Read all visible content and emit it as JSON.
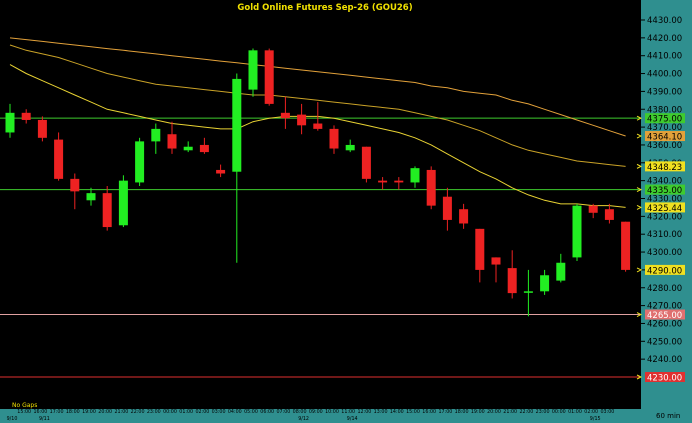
{
  "chart_data": {
    "type": "candlestick",
    "title": "Gold  Online  Futures  Sep-26  (GOU26)",
    "timeframe_label": "60  min",
    "corner_label": "No  Gaps",
    "ylim": [
      4230,
      4440
    ],
    "y_ticks": [
      4240,
      4250,
      4260,
      4270,
      4280,
      4290,
      4300,
      4310,
      4320,
      4330,
      4340,
      4350,
      4360,
      4370,
      4380,
      4390,
      4400,
      4410,
      4420,
      4430
    ],
    "date_labels": [
      {
        "label": "9/10",
        "index": 0
      },
      {
        "label": "9/11",
        "index": 2
      },
      {
        "label": "9/12",
        "index": 18
      },
      {
        "label": "9/14",
        "index": 21
      },
      {
        "label": "9/15",
        "index": 36
      }
    ],
    "time_labels": [
      "15:00",
      "16:00",
      "17:00",
      "18:00",
      "19:00",
      "20:00",
      "21:00",
      "22:00",
      "23:00",
      "00:00",
      "01:00",
      "02:00",
      "03:00",
      "04:00",
      "05:00",
      "06:00",
      "07:00",
      "08:00",
      "09:00",
      "10:00",
      "11:00",
      "12:00",
      "13:00",
      "14:00",
      "15:00",
      "16:00",
      "17:00",
      "18:00",
      "19:00",
      "20:00",
      "21:00",
      "22:00",
      "23:00",
      "00:00",
      "01:00",
      "02:00",
      "03:00"
    ],
    "candles": [
      {
        "o": 4367,
        "h": 4383,
        "l": 4364,
        "c": 4378
      },
      {
        "o": 4378,
        "h": 4380,
        "l": 4372,
        "c": 4374
      },
      {
        "o": 4374,
        "h": 4376,
        "l": 4362,
        "c": 4364
      },
      {
        "o": 4363,
        "h": 4367,
        "l": 4340,
        "c": 4341
      },
      {
        "o": 4341,
        "h": 4344,
        "l": 4324,
        "c": 4334
      },
      {
        "o": 4329,
        "h": 4336,
        "l": 4326,
        "c": 4333
      },
      {
        "o": 4333,
        "h": 4337,
        "l": 4312,
        "c": 4314
      },
      {
        "o": 4315,
        "h": 4343,
        "l": 4314,
        "c": 4340
      },
      {
        "o": 4339,
        "h": 4364,
        "l": 4337,
        "c": 4362
      },
      {
        "o": 4362,
        "h": 4372,
        "l": 4355,
        "c": 4369
      },
      {
        "o": 4366,
        "h": 4373,
        "l": 4355,
        "c": 4358
      },
      {
        "o": 4357,
        "h": 4362,
        "l": 4356,
        "c": 4359
      },
      {
        "o": 4360,
        "h": 4364,
        "l": 4355,
        "c": 4356
      },
      {
        "o": 4346,
        "h": 4349,
        "l": 4342,
        "c": 4344
      },
      {
        "o": 4345,
        "h": 4400,
        "l": 4294,
        "c": 4397
      },
      {
        "o": 4391,
        "h": 4414,
        "l": 4387,
        "c": 4413
      },
      {
        "o": 4413,
        "h": 4414,
        "l": 4382,
        "c": 4383
      },
      {
        "o": 4378,
        "h": 4387,
        "l": 4369,
        "c": 4375
      },
      {
        "o": 4377,
        "h": 4383,
        "l": 4366,
        "c": 4371
      },
      {
        "o": 4372,
        "h": 4384,
        "l": 4368,
        "c": 4369
      },
      {
        "o": 4369,
        "h": 4371,
        "l": 4355,
        "c": 4358
      },
      {
        "o": 4357,
        "h": 4363,
        "l": 4356,
        "c": 4360
      },
      {
        "o": 4359,
        "h": 4359,
        "l": 4339,
        "c": 4341
      },
      {
        "o": 4340,
        "h": 4342,
        "l": 4335,
        "c": 4339
      },
      {
        "o": 4340,
        "h": 4342,
        "l": 4335,
        "c": 4339
      },
      {
        "o": 4339,
        "h": 4348,
        "l": 4336,
        "c": 4347
      },
      {
        "o": 4346,
        "h": 4348,
        "l": 4324,
        "c": 4326
      },
      {
        "o": 4331,
        "h": 4336,
        "l": 4312,
        "c": 4318
      },
      {
        "o": 4324,
        "h": 4327,
        "l": 4313,
        "c": 4316
      },
      {
        "o": 4313,
        "h": 4313,
        "l": 4283,
        "c": 4290
      },
      {
        "o": 4297,
        "h": 4297,
        "l": 4283,
        "c": 4293
      },
      {
        "o": 4291,
        "h": 4301,
        "l": 4274,
        "c": 4277
      },
      {
        "o": 4278,
        "h": 4290,
        "l": 4264,
        "c": 4278
      },
      {
        "o": 4278,
        "h": 4290,
        "l": 4276,
        "c": 4287
      },
      {
        "o": 4284,
        "h": 4299,
        "l": 4283,
        "c": 4294
      },
      {
        "o": 4297,
        "h": 4327,
        "l": 4295,
        "c": 4326
      },
      {
        "o": 4326,
        "h": 4327,
        "l": 4319,
        "c": 4322
      },
      {
        "o": 4324,
        "h": 4327,
        "l": 4316,
        "c": 4318
      },
      {
        "o": 4317,
        "h": 4317,
        "l": 4289,
        "c": 4290
      }
    ],
    "moving_averages": [
      {
        "color": "#e2a13a",
        "values": [
          4420,
          4419,
          4418,
          4417,
          4416,
          4415,
          4414,
          4413,
          4412,
          4411,
          4410,
          4409,
          4408,
          4407,
          4406,
          4405,
          4404,
          4403,
          4402,
          4401,
          4400,
          4399,
          4398,
          4397,
          4396,
          4395,
          4393,
          4392,
          4390,
          4389,
          4388,
          4385,
          4383,
          4380,
          4377,
          4374,
          4371,
          4368,
          4365
        ]
      },
      {
        "color": "#c9a227",
        "values": [
          4416,
          4413,
          4411,
          4409,
          4406,
          4403,
          4400,
          4398,
          4396,
          4394,
          4393,
          4392,
          4391,
          4390,
          4389,
          4388,
          4388,
          4387,
          4386,
          4385,
          4384,
          4383,
          4382,
          4381,
          4380,
          4378,
          4376,
          4374,
          4371,
          4368,
          4364,
          4360,
          4357,
          4355,
          4353,
          4351,
          4350,
          4349,
          4348
        ]
      },
      {
        "color": "#e8d233",
        "values": [
          4405,
          4400,
          4396,
          4392,
          4388,
          4384,
          4380,
          4378,
          4376,
          4374,
          4372,
          4371,
          4370,
          4369,
          4369,
          4373,
          4375,
          4376,
          4376,
          4376,
          4375,
          4373,
          4371,
          4369,
          4367,
          4364,
          4360,
          4355,
          4350,
          4345,
          4341,
          4336,
          4332,
          4329,
          4327,
          4327,
          4326,
          4326,
          4325
        ]
      }
    ],
    "horizontal_lines": [
      {
        "value": 4375,
        "label": "4375.00",
        "color": "#3ecb2e",
        "label_bg": "#3ecb2e",
        "label_fg": "#000000"
      },
      {
        "value": 4335,
        "label": "4335.00",
        "color": "#3ecb2e",
        "label_bg": "#3ecb2e",
        "label_fg": "#000000"
      },
      {
        "value": 4265,
        "label": "4265.00",
        "color": "#e0a0a0",
        "label_bg": "#e07070",
        "label_fg": "#ffffff"
      },
      {
        "value": 4230,
        "label": "4230.00",
        "color": "#e03030",
        "label_bg": "#e03030",
        "label_fg": "#ffffff"
      }
    ],
    "price_tags": [
      {
        "value": 4365,
        "label": "4364.10",
        "bg": "#e2a13a",
        "fg": "#000000"
      },
      {
        "value": 4348,
        "label": "4348.23",
        "bg": "#f0e020",
        "fg": "#000000"
      },
      {
        "value": 4325,
        "label": "4325.44",
        "bg": "#f0e020",
        "fg": "#000000"
      },
      {
        "value": 4290,
        "label": "4290.00",
        "bg": "#f0e020",
        "fg": "#000000"
      }
    ],
    "colors": {
      "background": "#000000",
      "up": "#22ee22",
      "down": "#ee2222",
      "axis_bg": "#2f8f8f",
      "tick_text": "#000000",
      "title": "#f0e000"
    }
  }
}
